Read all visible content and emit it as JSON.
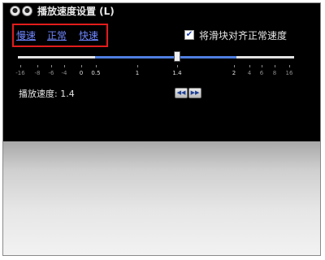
{
  "window": {
    "title": "播放速度设置 (L)"
  },
  "speed_links": [
    "慢速",
    "正常",
    "快速"
  ],
  "snap_checkbox": {
    "label": "将滑块对齐正常速度",
    "checked": true
  },
  "slider": {
    "value": 1.4,
    "tick_labels": [
      "-16",
      "-8",
      "-6",
      "-4",
      "0",
      "0.5",
      "1",
      "1.4",
      "2",
      "4",
      "6",
      "8",
      "16"
    ]
  },
  "readout": {
    "text": "播放速度: 1.4"
  },
  "colors": {
    "link": "#6f86ff",
    "highlight_box": "#e31c1c",
    "slider_range": "#4f7fe0",
    "background_dark": "#000000"
  },
  "icons": {
    "step_back": "step-back-icon",
    "step_forward": "step-forward-icon"
  }
}
